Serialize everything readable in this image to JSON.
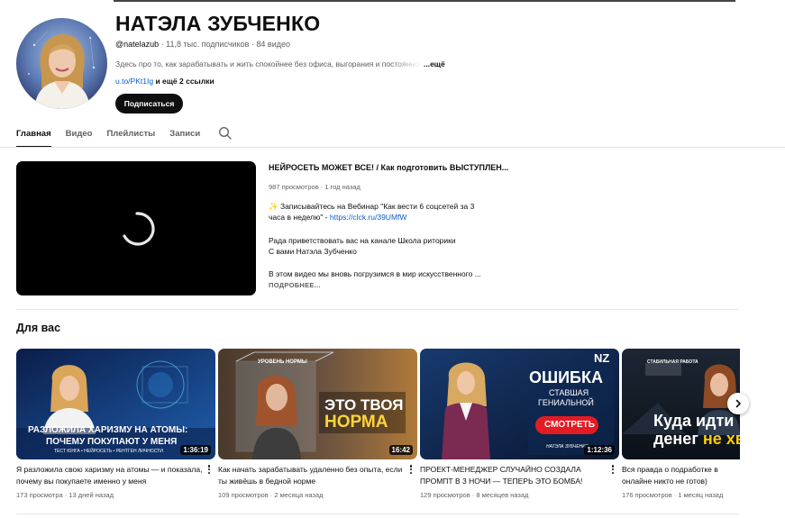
{
  "channel": {
    "name": "НАТЭЛА ЗУБЧЕНКО",
    "handle": "@natelazub",
    "stats": "· 11,8 тыс. подписчиков · 84 видео",
    "description": "Здесь про то, как зарабатывать и жить спокойнее без офиса, выгорания и постоянной суеты",
    "description_more": "...ещё",
    "link_text": "u.to/PKt1Ig",
    "links_more": "и ещё 2 ссылки",
    "subscribe_label": "Подписаться"
  },
  "tabs": [
    {
      "label": "Главная",
      "active": true
    },
    {
      "label": "Видео",
      "active": false
    },
    {
      "label": "Плейлисты",
      "active": false
    },
    {
      "label": "Записи",
      "active": false
    }
  ],
  "featured": {
    "title": "НЕЙРОСЕТЬ МОЖЕТ ВСЕ! / Как подготовить ВЫСТУПЛЕН...",
    "meta": "987 просмотров · 1 год назад",
    "line1_prefix": "✨ Записывайтесь на Вебинар \"Как вести 6 соцсетей за 3",
    "line2_prefix": "часа в неделю\" - ",
    "line2_link": "https://clck.ru/39UMfW",
    "line3": "Рада приветствовать вас на канале Школа риторики",
    "line4": "С вами Натэла Зубченко",
    "line5": "В этом видео мы вновь погрузимся в мир искусственного ...",
    "more_label": "ПОДРОБНЕЕ..."
  },
  "section": {
    "title": "Для вас"
  },
  "videos": [
    {
      "title": "Я разложила свою харизму на атомы — и показала, почему вы покупаете именно у меня",
      "meta": "173 просмотра · 13 дней назад",
      "duration": "1:36:19",
      "thumb_lines": [
        "РАЗЛОЖИЛА ХАРИЗМУ НА АТОМЫ:",
        "ПОЧЕМУ ПОКУПАЮТ У МЕНЯ",
        "ТЕСТ ЮНГА • НЕЙРОСЕТЬ • РЕНТГЕН ЛИЧНОСТИ"
      ]
    },
    {
      "title": "Как начать зарабатывать удаленно без опыта, если ты живёшь в бедной норме",
      "meta": "109 просмотров · 2 месяца назад",
      "duration": "16:42",
      "thumb_lines": [
        "УРОВЕНЬ НОРМЫ",
        "ЭТО ТВОЯ",
        "НОРМА"
      ]
    },
    {
      "title": "ПРОЕКТ-МЕНЕДЖЕР СЛУЧАЙНО СОЗДАЛА ПРОМПТ В 3 НОЧИ — ТЕПЕРЬ ЭТО БОМБА!",
      "meta": "129 просмотров · 8 месяцев назад",
      "duration": "1:12:36",
      "thumb_lines": [
        "NZ",
        "ОШИБКА",
        "СТАВШАЯ",
        "ГЕНИАЛЬНОЙ",
        "СМОТРЕТЬ",
        "НАТЭЛА ЗУБЧЕНКО"
      ]
    },
    {
      "title": "Вся правда о подработке в онлайне никто не готов)",
      "meta": "176 просмотров · 1 месяц назад",
      "duration": "",
      "thumb_lines": [
        "СТАБИЛЬНАЯ РАБОТА",
        "Куда идти",
        "денег",
        "не хв"
      ]
    }
  ],
  "colors": {
    "link": "#065fd4",
    "subscribe_bg": "#0f0f0f",
    "muted_text": "#606060",
    "thumb3_accent": "#e31b23"
  },
  "icons": [
    "search-icon",
    "loading-spinner-icon",
    "more-vert-icon",
    "chevron-right-icon"
  ]
}
